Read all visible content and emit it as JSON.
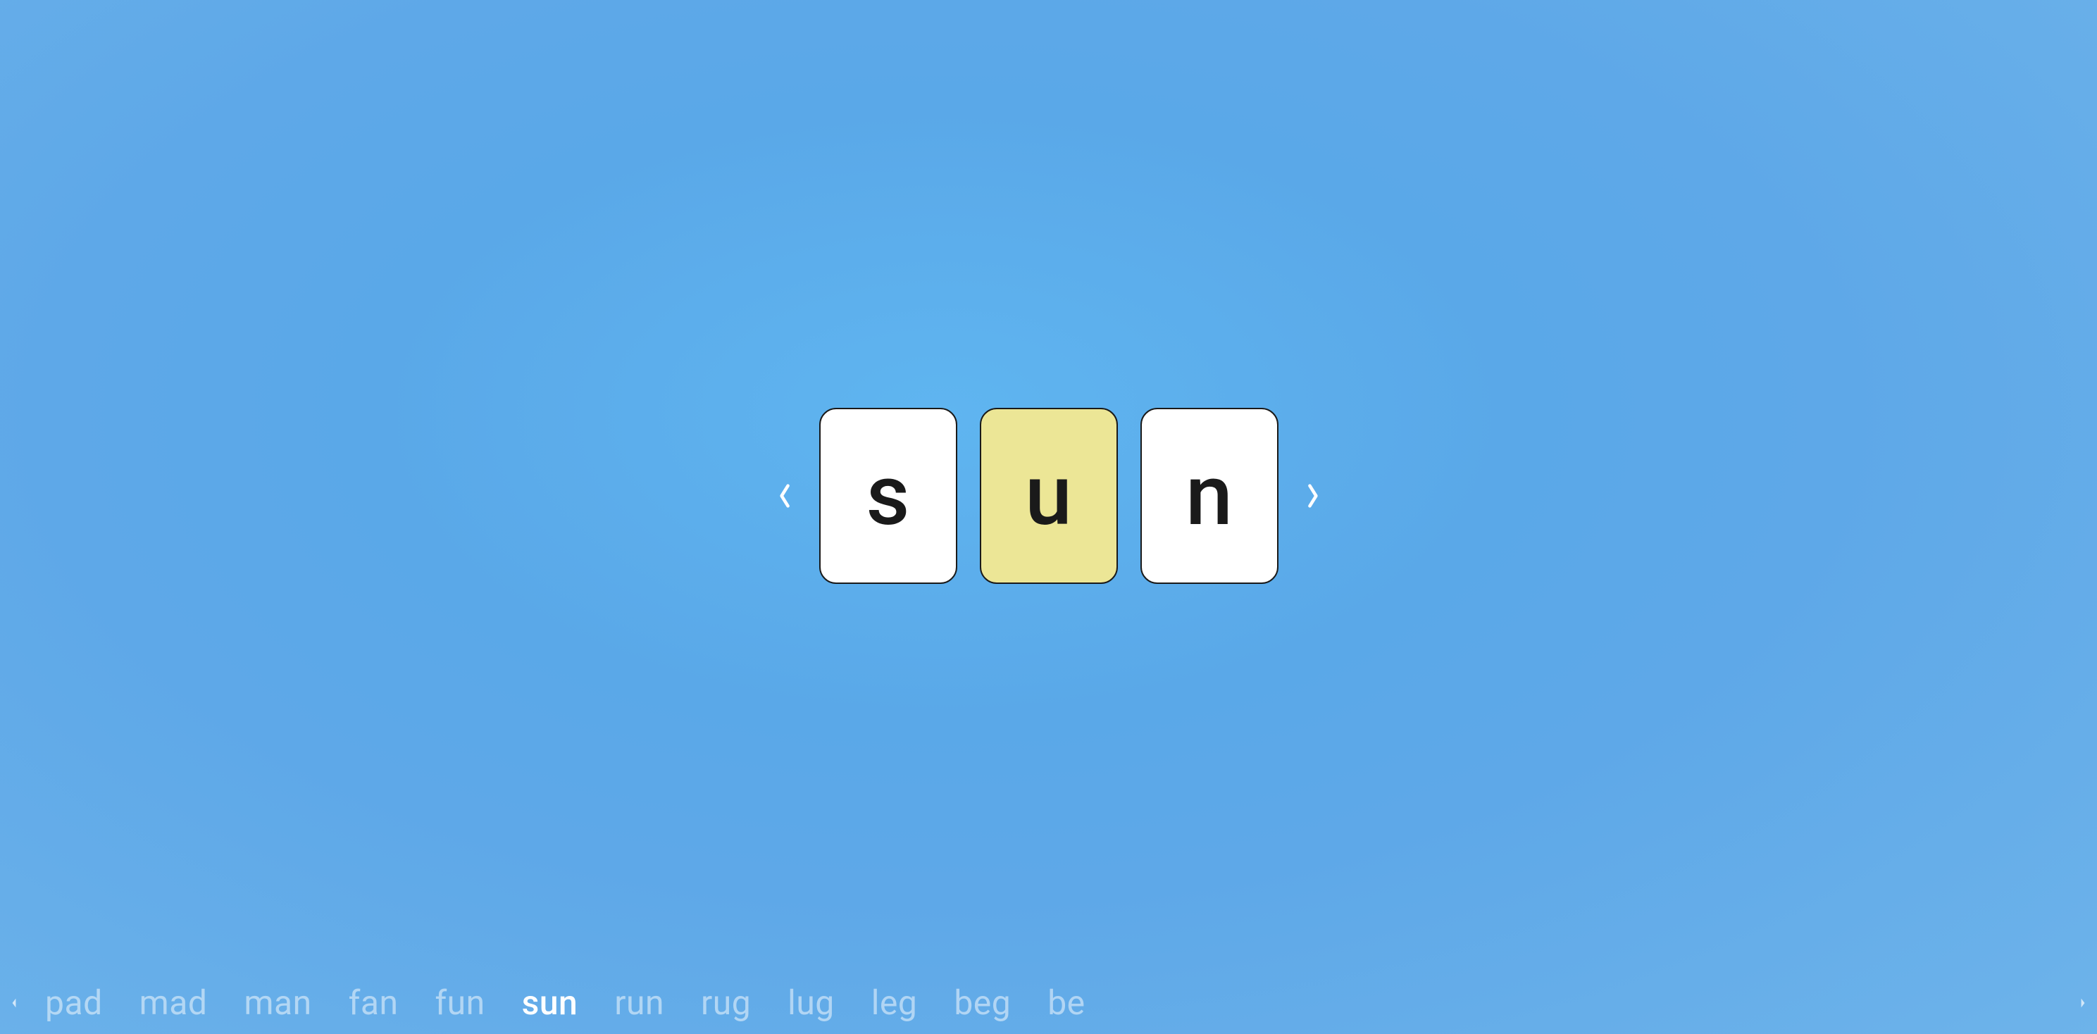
{
  "current_word": {
    "letters": [
      "s",
      "u",
      "n"
    ],
    "highlighted_index": 1
  },
  "word_list": {
    "items": [
      "pad",
      "mad",
      "man",
      "fan",
      "fun",
      "sun",
      "run",
      "rug",
      "lug",
      "leg",
      "beg",
      "be"
    ],
    "active_index": 5
  },
  "colors": {
    "card_bg": "#ffffff",
    "card_highlight": "#ece696",
    "card_border": "#1a1a1a",
    "text": "#1a1a1a",
    "bg_gradient_inner": "#5fb5f0",
    "bg_gradient_outer": "#6db3ea"
  }
}
